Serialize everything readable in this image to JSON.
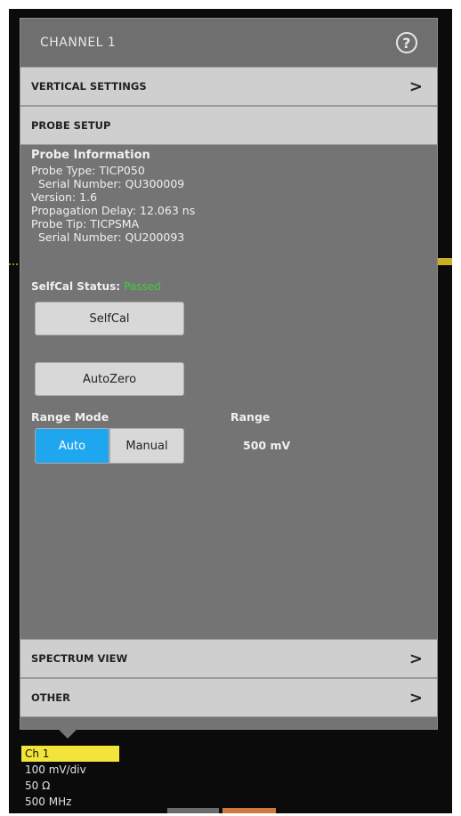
{
  "header": {
    "title": "CHANNEL 1",
    "help_icon": "?"
  },
  "sections": {
    "vertical": "VERTICAL SETTINGS",
    "probe_setup": "PROBE SETUP",
    "spectrum": "SPECTRUM VIEW",
    "other": "OTHER",
    "chevron": ">"
  },
  "probe": {
    "title": "Probe Information",
    "type": "Probe Type: TICP050",
    "serial": "Serial Number: QU300009",
    "version": "Version: 1.6",
    "delay": "Propagation Delay: 12.063 ns",
    "tip": "Probe Tip: TICPSMA",
    "tip_serial": "Serial Number: QU200093"
  },
  "selfcal": {
    "status_label": "SelfCal Status:",
    "status_value": "Passed",
    "button": "SelfCal"
  },
  "autozero": {
    "button": "AutoZero"
  },
  "range_mode": {
    "label": "Range Mode",
    "auto": "Auto",
    "manual": "Manual"
  },
  "range": {
    "label": "Range",
    "value": "500 mV"
  },
  "channel_badge": {
    "name": "Ch 1",
    "scale": "100 mV/div",
    "termination": "50 Ω",
    "bandwidth": "500 MHz"
  },
  "colors": {
    "accent": "#1ea6ef",
    "status_ok": "#3ccf3c",
    "badge": "#f2e43a"
  }
}
